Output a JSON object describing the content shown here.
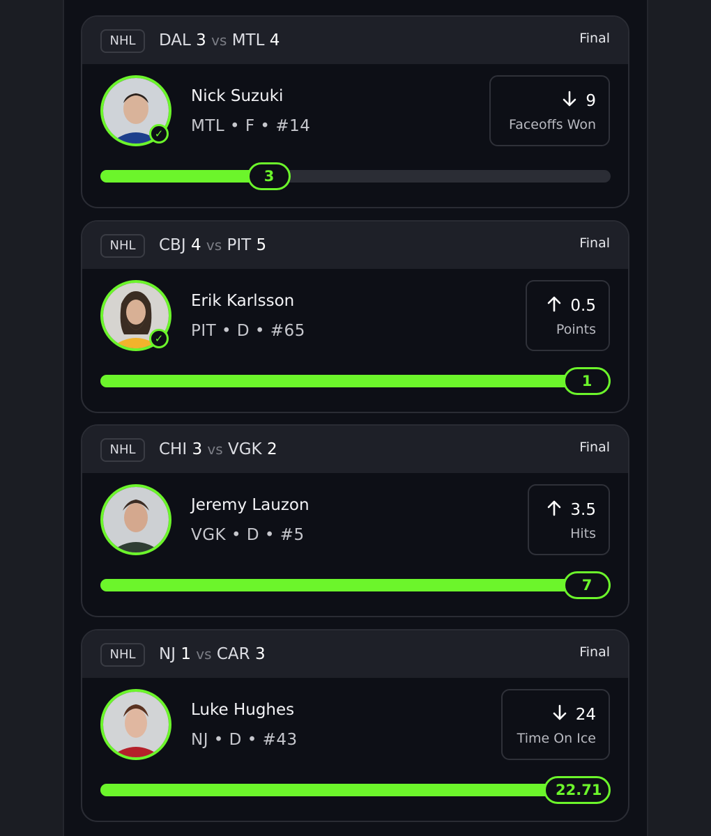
{
  "cards": [
    {
      "league": "NHL",
      "away_team": "DAL",
      "away_score": "3",
      "vs": "vs",
      "home_team": "MTL",
      "home_score": "4",
      "status": "Final",
      "player_name": "Nick Suzuki",
      "player_meta": "MTL • F • #14",
      "verified": true,
      "direction": "down",
      "line": "9",
      "stat": "Faceoffs Won",
      "result": "3",
      "progress_fraction": 0.33
    },
    {
      "league": "NHL",
      "away_team": "CBJ",
      "away_score": "4",
      "vs": "vs",
      "home_team": "PIT",
      "home_score": "5",
      "status": "Final",
      "player_name": "Erik Karlsson",
      "player_meta": "PIT • D • #65",
      "verified": true,
      "direction": "up",
      "line": "0.5",
      "stat": "Points",
      "result": "1",
      "progress_fraction": 1.0
    },
    {
      "league": "NHL",
      "away_team": "CHI",
      "away_score": "3",
      "vs": "vs",
      "home_team": "VGK",
      "home_score": "2",
      "status": "Final",
      "player_name": "Jeremy Lauzon",
      "player_meta": "VGK • D • #5",
      "verified": false,
      "direction": "up",
      "line": "3.5",
      "stat": "Hits",
      "result": "7",
      "progress_fraction": 1.0
    },
    {
      "league": "NHL",
      "away_team": "NJ",
      "away_score": "1",
      "vs": "vs",
      "home_team": "CAR",
      "home_score": "3",
      "status": "Final",
      "player_name": "Luke Hughes",
      "player_meta": "NJ • D • #43",
      "verified": false,
      "direction": "down",
      "line": "24",
      "stat": "Time On Ice",
      "result": "22.71",
      "progress_fraction": 0.95
    }
  ],
  "colors": {
    "accent": "#6cf52b",
    "background": "#0e1017",
    "card_header": "#1e2028",
    "track": "#2b2d35"
  },
  "icons": {
    "up": "arrow-up-icon",
    "down": "arrow-down-icon",
    "check": "checkmark-icon"
  }
}
